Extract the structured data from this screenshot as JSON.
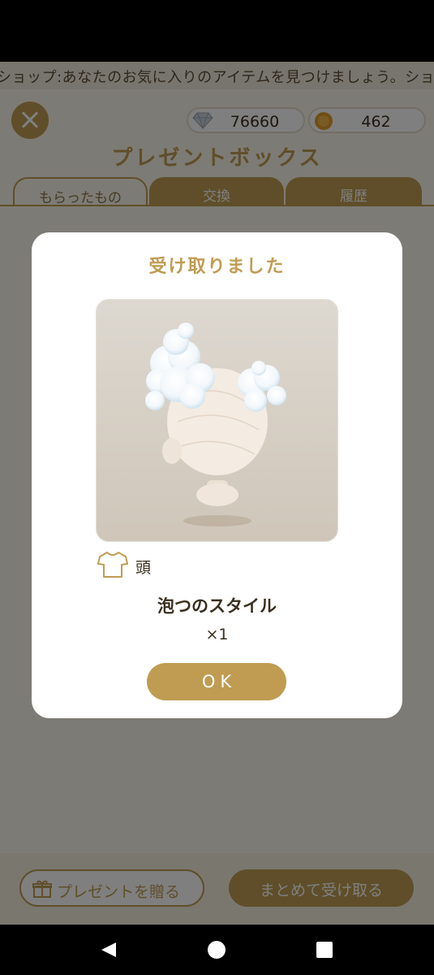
{
  "ticker": {
    "text": "ショップ:あなたのお気に入りのアイテムを見つけましょう。ショップの"
  },
  "header": {
    "close_icon": "close-icon",
    "gems": {
      "icon": "diamond-icon",
      "value": "76660"
    },
    "coins": {
      "icon": "coin-icon",
      "value": "462"
    },
    "title": "プレゼントボックス"
  },
  "tabs": [
    {
      "label": "もらったもの",
      "active": true
    },
    {
      "label": "交換",
      "active": false
    },
    {
      "label": "履歴",
      "active": false
    }
  ],
  "footer": {
    "gift_label": "プレゼントを贈る",
    "gift_icon": "gift-icon",
    "receive_all_label": "まとめて受け取る"
  },
  "modal": {
    "title": "受け取りました",
    "item_image": "foam-style-hair-item",
    "category_icon": "shirt-icon",
    "category_label": "頭",
    "item_name": "泡つのスタイル",
    "quantity": "×1",
    "ok_label": "OK"
  },
  "navbar": {
    "back_icon": "back-triangle-icon",
    "home_icon": "home-circle-icon",
    "recent_icon": "recent-square-icon"
  },
  "colors": {
    "accent": "#bf9c52",
    "background": "#fbf6ea",
    "text": "#3a2f1e"
  }
}
